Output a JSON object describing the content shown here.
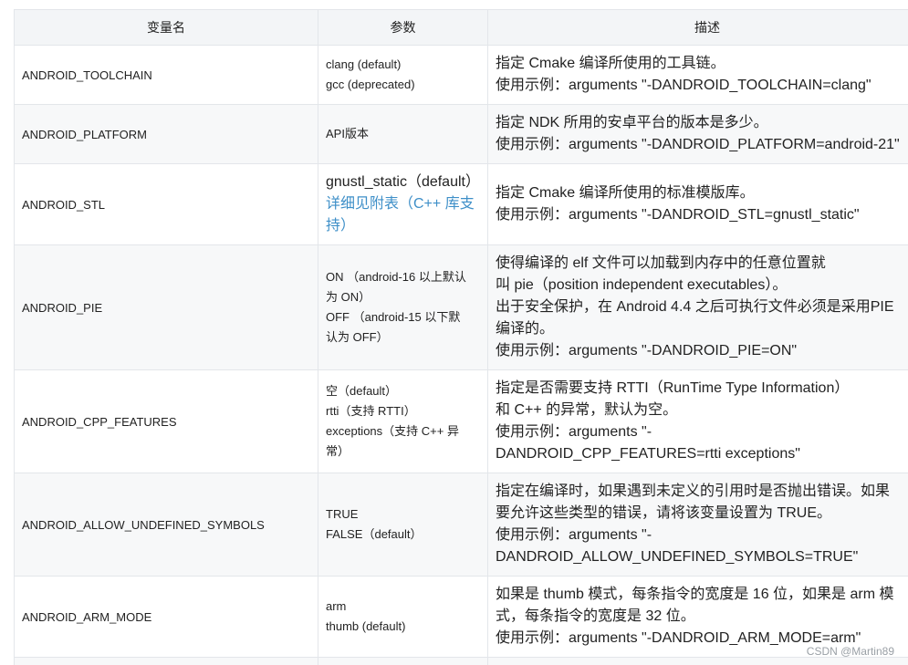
{
  "headers": [
    "变量名",
    "参数",
    "描述"
  ],
  "rows": [
    {
      "name": "ANDROID_TOOLCHAIN",
      "params": [
        "clang (default)",
        "gcc (deprecated)"
      ],
      "desc": [
        "指定 Cmake 编译所使用的工具链。",
        "使用示例：arguments \"-DANDROID_TOOLCHAIN=clang\""
      ]
    },
    {
      "name": "ANDROID_PLATFORM",
      "params": [
        "API版本"
      ],
      "desc": [
        "指定 NDK 所用的安卓平台的版本是多少。",
        "使用示例：arguments \"-DANDROID_PLATFORM=android-21\""
      ]
    },
    {
      "name": "ANDROID_STL",
      "params": [
        "gnustl_static（default）"
      ],
      "params_link": [
        "详细见附表（C++ 库支",
        "持）"
      ],
      "desc": [
        "指定 Cmake 编译所使用的标准模版库。",
        "使用示例：arguments \"-DANDROID_STL=gnustl_static\""
      ]
    },
    {
      "name": "ANDROID_PIE",
      "params": [
        "ON （android-16 以上默认",
        "为 ON）",
        "OFF （android-15 以下默",
        "认为 OFF）"
      ],
      "desc": [
        "使得编译的 elf 文件可以加载到内存中的任意位置就",
        "叫 pie（position independent executables）。",
        "出于安全保护，在 Android 4.4 之后可执行文件必须是采用PIE",
        "编译的。",
        "使用示例：arguments \"-DANDROID_PIE=ON\""
      ]
    },
    {
      "name": "ANDROID_CPP_FEATURES",
      "params": [
        "空（default）",
        "rtti（支持 RTTI）",
        "exceptions（支持 C++ 异",
        "常）"
      ],
      "desc": [
        "指定是否需要支持 RTTI（RunTime Type Information）",
        "和 C++ 的异常，默认为空。",
        "使用示例：arguments \"-",
        "DANDROID_CPP_FEATURES=rtti exceptions\""
      ]
    },
    {
      "name": "ANDROID_ALLOW_UNDEFINED_SYMBOLS",
      "params": [
        "TRUE",
        "FALSE（default）"
      ],
      "desc": [
        "指定在编译时，如果遇到未定义的引用时是否抛出错误。如果",
        "要允许这些类型的错误，请将该变量设置为 TRUE。",
        "使用示例：arguments \"-",
        "DANDROID_ALLOW_UNDEFINED_SYMBOLS=TRUE\""
      ]
    },
    {
      "name": "ANDROID_ARM_MODE",
      "params": [
        "arm",
        "thumb (default)"
      ],
      "desc": [
        "如果是 thumb 模式，每条指令的宽度是 16 位，如果是 arm 模",
        "式，每条指令的宽度是 32 位。",
        "使用示例：arguments \"-DANDROID_ARM_MODE=arm\""
      ]
    }
  ],
  "watermark": "CSDN @Martin89",
  "colors": {
    "header_bg": "#f3f5f7",
    "border": "#e3e6ea",
    "link": "#3e8fc8",
    "alt_row": "#f7f8f9"
  }
}
